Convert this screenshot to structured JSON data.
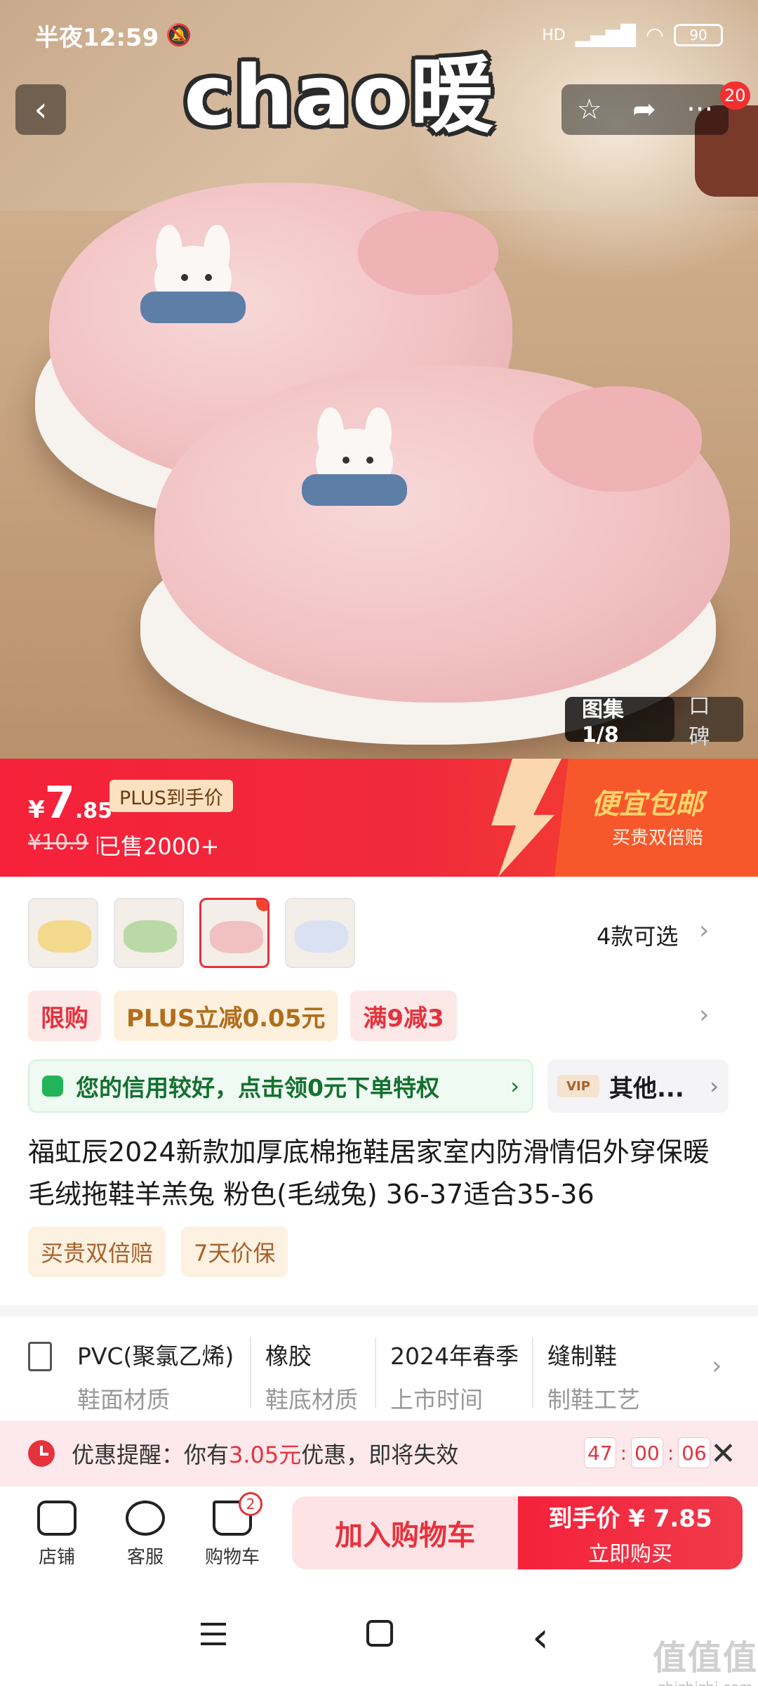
{
  "status_bar": {
    "time": "半夜12:59",
    "signal_label": "HD",
    "battery": "90"
  },
  "hero": {
    "overlay_text": "chao暖",
    "gallery_label": "图集1/8",
    "reviews_label": "口碑",
    "cart_badge": "20"
  },
  "price": {
    "currency": "¥",
    "integer": "7",
    "decimal": ".85",
    "plus_tag": "PLUS到手价",
    "original": "¥10.9",
    "sold": "已售2000+",
    "promo_title": "便宜包邮",
    "promo_sub": "买贵双倍赔"
  },
  "variants": {
    "count_label": "4款可选",
    "thumb_colors": [
      "#f3d98c",
      "#b9d9a6",
      "#f1c1c2",
      "#d9e1f2"
    ],
    "selected_index": 2
  },
  "promo_tags": [
    "限购",
    "PLUS立减0.05元",
    "满9减3"
  ],
  "credit_banner": {
    "text": "您的信用较好，点击领0元下单特权"
  },
  "other_banner": {
    "vip": "VIP",
    "text": "其他..."
  },
  "product_title": "福虹辰2024新款加厚底棉拖鞋居家室内防滑情侣外穿保暖毛绒拖鞋羊羔兔 粉色(毛绒兔) 36-37适合35-36",
  "service_tags": [
    "买贵双倍赔",
    "7天价保"
  ],
  "attributes": [
    {
      "value": "PVC(聚氯乙烯)",
      "label": "鞋面材质"
    },
    {
      "value": "橡胶",
      "label": "鞋底材质"
    },
    {
      "value": "2024年春季",
      "label": "上市时间"
    },
    {
      "value": "缝制鞋",
      "label": "制鞋工艺"
    }
  ],
  "reminder": {
    "prefix": "优惠提醒：你有",
    "amount": "3.05元",
    "suffix": "优惠，即将失效",
    "timer": [
      "47",
      "00",
      "06"
    ]
  },
  "action_bar": {
    "store": "店铺",
    "service": "客服",
    "cart": "购物车",
    "cart_count": "2",
    "add_to_cart": "加入购物车",
    "buy_price": "到手价 ¥ 7.85",
    "buy_now": "立即购买"
  },
  "watermark": {
    "line1": "值值值",
    "line2": "zhizhizhi.com"
  }
}
